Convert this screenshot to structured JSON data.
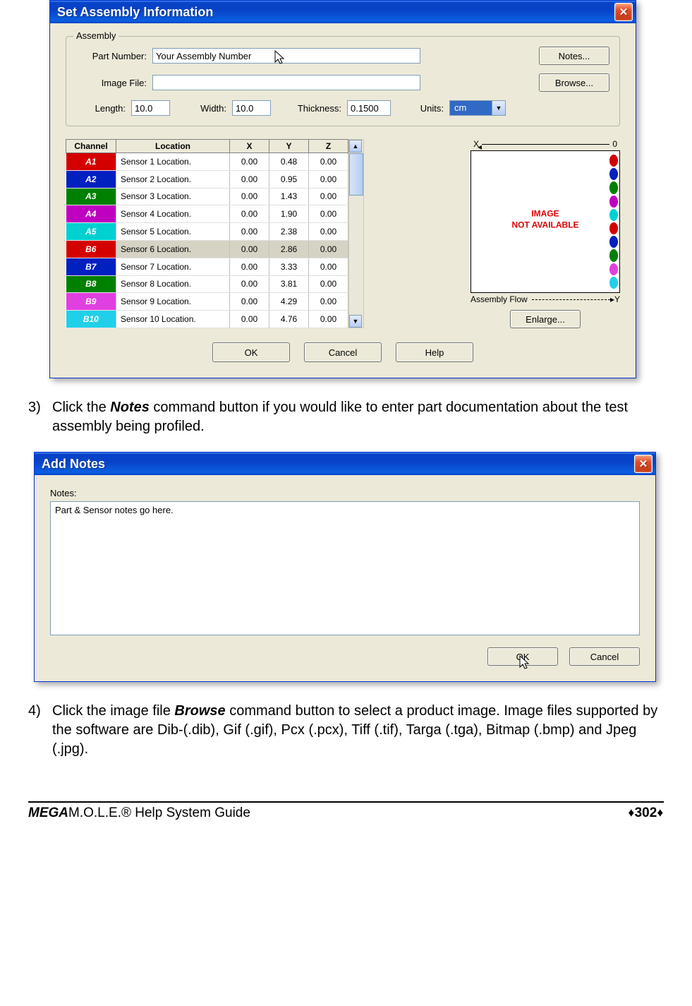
{
  "dialog1": {
    "title": "Set Assembly Information",
    "group_label": "Assembly",
    "part_number_label": "Part Number:",
    "part_number_value": "Your Assembly Number",
    "notes_btn": "Notes...",
    "image_file_label": "Image File:",
    "image_file_value": "",
    "browse_btn": "Browse...",
    "length_label": "Length:",
    "length_value": "10.0",
    "width_label": "Width:",
    "width_value": "10.0",
    "thickness_label": "Thickness:",
    "thickness_value": "0.1500",
    "units_label": "Units:",
    "units_value": "cm",
    "table": {
      "headers": [
        "Channel",
        "Location",
        "X",
        "Y",
        "Z"
      ],
      "rows": [
        {
          "ch": "A1",
          "color": "#d40000",
          "loc": "Sensor 1 Location.",
          "x": "0.00",
          "y": "0.48",
          "z": "0.00",
          "sel": false
        },
        {
          "ch": "A2",
          "color": "#0020c0",
          "loc": "Sensor 2 Location.",
          "x": "0.00",
          "y": "0.95",
          "z": "0.00",
          "sel": false
        },
        {
          "ch": "A3",
          "color": "#008000",
          "loc": "Sensor 3 Location.",
          "x": "0.00",
          "y": "1.43",
          "z": "0.00",
          "sel": false
        },
        {
          "ch": "A4",
          "color": "#c000c0",
          "loc": "Sensor 4 Location.",
          "x": "0.00",
          "y": "1.90",
          "z": "0.00",
          "sel": false
        },
        {
          "ch": "A5",
          "color": "#00d0d0",
          "loc": "Sensor 5 Location.",
          "x": "0.00",
          "y": "2.38",
          "z": "0.00",
          "sel": false
        },
        {
          "ch": "B6",
          "color": "#d40000",
          "loc": "Sensor 6 Location.",
          "x": "0.00",
          "y": "2.86",
          "z": "0.00",
          "sel": true
        },
        {
          "ch": "B7",
          "color": "#0020c0",
          "loc": "Sensor 7 Location.",
          "x": "0.00",
          "y": "3.33",
          "z": "0.00",
          "sel": false
        },
        {
          "ch": "B8",
          "color": "#008000",
          "loc": "Sensor 8 Location.",
          "x": "0.00",
          "y": "3.81",
          "z": "0.00",
          "sel": false
        },
        {
          "ch": "B9",
          "color": "#e040e0",
          "loc": "Sensor 9 Location.",
          "x": "0.00",
          "y": "4.29",
          "z": "0.00",
          "sel": false
        },
        {
          "ch": "B10",
          "color": "#20d0e8",
          "loc": "Sensor 10 Location.",
          "x": "0.00",
          "y": "4.76",
          "z": "0.00",
          "sel": false
        }
      ]
    },
    "preview": {
      "top_left_axis": "X",
      "top_right_axis": "0",
      "bottom_right_axis": "Y",
      "not_available": "IMAGE\nNOT AVAILABLE",
      "flow_label": "Assembly Flow",
      "enlarge_btn": "Enlarge..."
    },
    "ok_btn": "OK",
    "cancel_btn": "Cancel",
    "help_btn": "Help"
  },
  "step3": {
    "num": "3)",
    "text_before": "Click the ",
    "bold": "Notes",
    "text_after": " command button if you would like to enter part documentation about the test assembly being profiled."
  },
  "dialog2": {
    "title": "Add Notes",
    "notes_label": "Notes:",
    "notes_value": "Part & Sensor notes go here.",
    "ok_btn": "OK",
    "cancel_btn": "Cancel"
  },
  "step4": {
    "num": "4)",
    "text_before": "Click the image file ",
    "bold": "Browse",
    "text_after": " command button to select a product image. Image files supported by the software are Dib-(.dib), Gif (.gif), Pcx (.pcx), Tiff (.tif), Targa (.tga), Bitmap (.bmp) and Jpeg (.jpg)."
  },
  "footer": {
    "mega": "MEGA",
    "rest": "M.O.L.E.® Help System Guide",
    "pagenum": "302"
  }
}
